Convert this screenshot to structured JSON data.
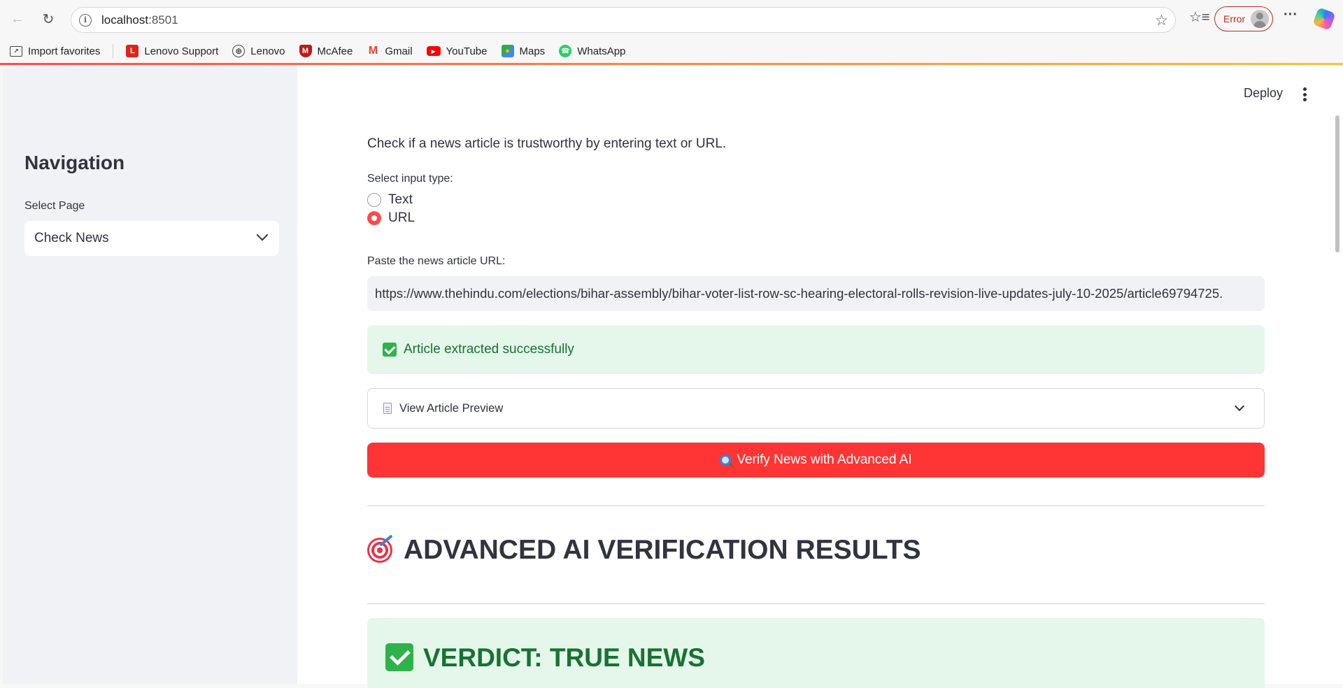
{
  "browser": {
    "url_host": "localhost",
    "url_port": ":8501",
    "profile_status": "Error",
    "favorites": [
      {
        "label": "Import favorites",
        "icon": "import-icon"
      },
      {
        "label": "Lenovo Support",
        "icon": "lenovo-support-icon",
        "color": "#e2231a"
      },
      {
        "label": "Lenovo",
        "icon": "globe-icon"
      },
      {
        "label": "McAfee",
        "icon": "mcafee-icon",
        "color": "#c01818"
      },
      {
        "label": "Gmail",
        "icon": "gmail-icon",
        "color": "#ea4335"
      },
      {
        "label": "YouTube",
        "icon": "youtube-icon",
        "color": "#ff0000"
      },
      {
        "label": "Maps",
        "icon": "maps-icon",
        "color": "#34a853"
      },
      {
        "label": "WhatsApp",
        "icon": "whatsapp-icon",
        "color": "#25d366"
      }
    ]
  },
  "sidebar": {
    "title": "Navigation",
    "select_label": "Select Page",
    "selected_page": "Check News"
  },
  "header": {
    "deploy_label": "Deploy"
  },
  "main": {
    "intro": "Check if a news article is trustworthy by entering text or URL.",
    "input_type_label": "Select input type:",
    "input_types": [
      "Text",
      "URL"
    ],
    "selected_input_type": "URL",
    "url_label": "Paste the news article URL:",
    "url_value": "https://www.thehindu.com/elections/bihar-assembly/bihar-voter-list-row-sc-hearing-electoral-rolls-revision-live-updates-july-10-2025/article69794725.",
    "success_message": "Article extracted successfully",
    "preview_label": "View Article Preview",
    "verify_button": "Verify News with Advanced AI",
    "results_title": "ADVANCED AI VERIFICATION RESULTS",
    "verdict": "VERDICT: TRUE NEWS"
  },
  "colors": {
    "primary": "#ff4b4b",
    "success_bg": "#e5f7ea",
    "success_text": "#177233",
    "sidebar_bg": "#f0f2f6"
  }
}
